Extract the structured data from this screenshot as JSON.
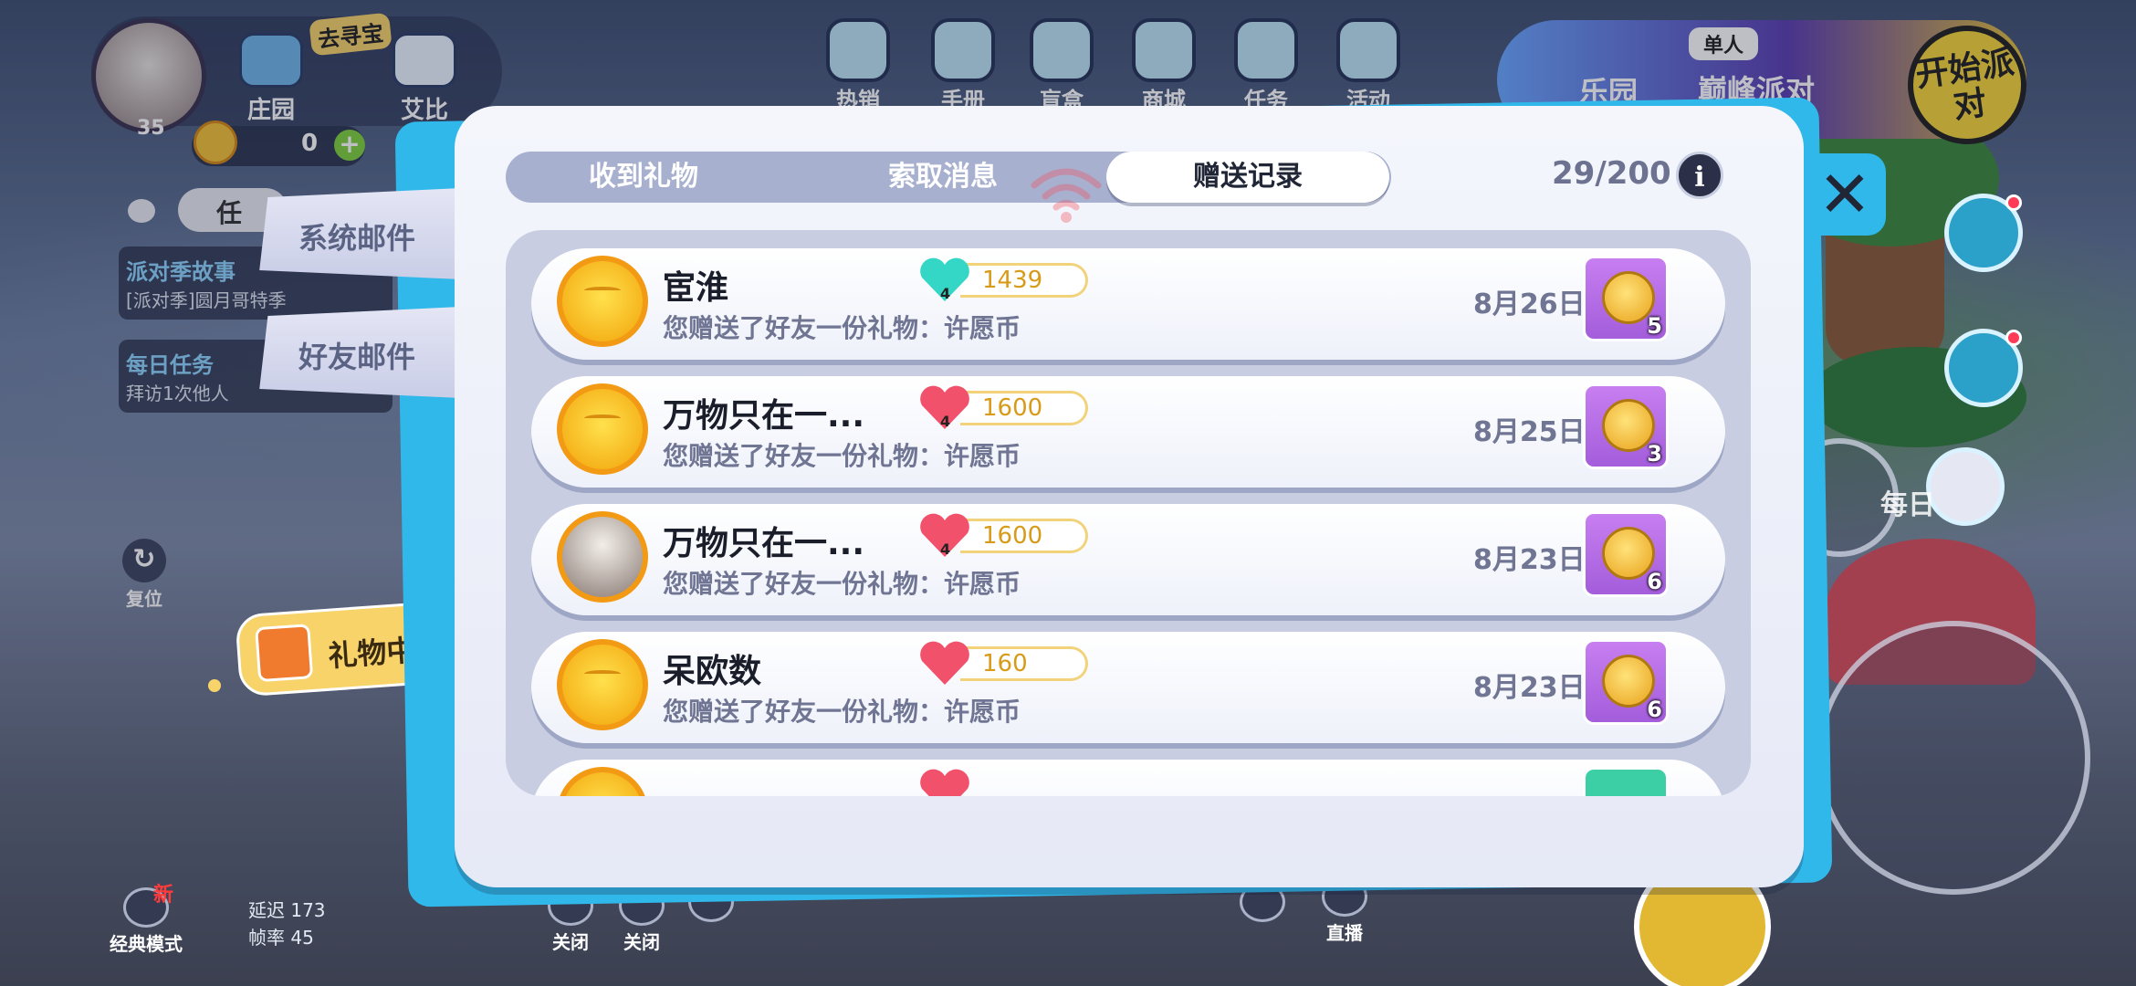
{
  "hud": {
    "level": "35",
    "home_label": "庄园",
    "treasure_label": "去寻宝",
    "pet_label": "艾比",
    "coins": "0",
    "coin_plus": "+",
    "task_pill": "任",
    "side_story_title": "派对季故事",
    "side_story_sub": "[派对季]圆月哥特季",
    "side_daily_title": "每日任务",
    "side_daily_sub": "拜访1次他人",
    "reset_label": "复位",
    "reset_icon": "↻",
    "gift_center": "礼物中心",
    "classic_mode": "经典模式",
    "new_badge": "新",
    "latency": "延迟 173",
    "fps": "帧率 45",
    "close_label_1": "关闭",
    "close_label_2": "关闭",
    "live_label": "直播",
    "daily_partial": "每日"
  },
  "top_menu": [
    "热销",
    "手册",
    "盲盒",
    "商城",
    "任务",
    "活动"
  ],
  "party": {
    "single": "单人",
    "mode": "巅峰派对",
    "park": "乐园",
    "start": "开始派对"
  },
  "mail_tabs": {
    "system": "系统邮件",
    "friend": "好友邮件"
  },
  "dialog": {
    "tabs": [
      "收到礼物",
      "索取消息",
      "赠送记录"
    ],
    "active_tab": "赠送记录",
    "counter": "29/200",
    "info": "i",
    "close": "✕"
  },
  "records": [
    {
      "name": "宦淮",
      "desc": "您赠送了好友一份礼物：许愿币",
      "heart_level": "4",
      "points": "1439",
      "date": "8月26日",
      "gift_count": "5",
      "heart_color": "#34d6c6",
      "avatar": "default"
    },
    {
      "name": "万物只在一...",
      "desc": "您赠送了好友一份礼物：许愿币",
      "heart_level": "4",
      "points": "1600",
      "date": "8月25日",
      "gift_count": "3",
      "heart_color": "#f2516b",
      "avatar": "default"
    },
    {
      "name": "万物只在一...",
      "desc": "您赠送了好友一份礼物：许愿币",
      "heart_level": "4",
      "points": "1600",
      "date": "8月23日",
      "gift_count": "6",
      "heart_color": "#f2516b",
      "avatar": "photo"
    },
    {
      "name": "呆欧数",
      "desc": "您赠送了好友一份礼物：许愿币",
      "heart_level": "",
      "points": "160",
      "date": "8月23日",
      "gift_count": "6",
      "heart_color": "#f2516b",
      "avatar": "default"
    }
  ],
  "icons": {
    "info": "info-icon",
    "close": "close-icon",
    "gift": "coin-gift-icon",
    "heart": "friendship-heart-icon",
    "wifi": "weak-signal-icon"
  }
}
